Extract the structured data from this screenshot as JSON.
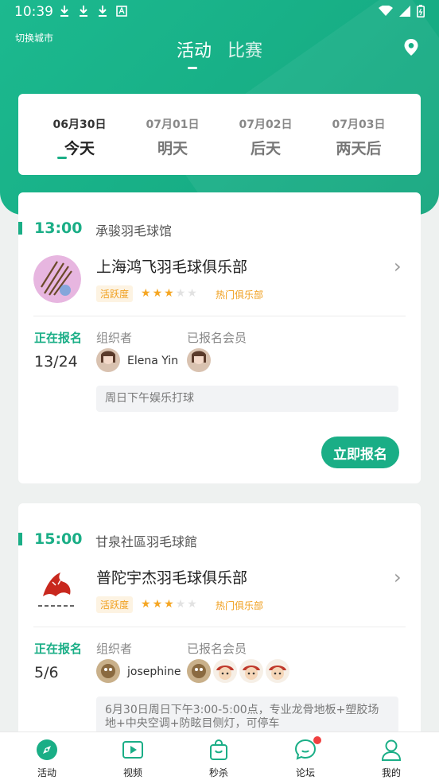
{
  "status_bar": {
    "time": "10:39",
    "icons": [
      "download-icon",
      "download-icon",
      "download-icon",
      "font-icon",
      "wifi-icon",
      "signal-icon",
      "battery-icon"
    ]
  },
  "header": {
    "city_switch": "切换城市",
    "tabs": [
      {
        "label": "活动",
        "active": true
      },
      {
        "label": "比赛",
        "active": false
      }
    ],
    "location_icon": "location-pin-icon"
  },
  "dates": [
    {
      "date": "06月30日",
      "label": "今天",
      "active": true
    },
    {
      "date": "07月01日",
      "label": "明天",
      "active": false
    },
    {
      "date": "07月02日",
      "label": "后天",
      "active": false
    },
    {
      "date": "07月03日",
      "label": "两天后",
      "active": false
    }
  ],
  "events": [
    {
      "time": "13:00",
      "venue": "承骏羽毛球馆",
      "club_name": "上海鸿飞羽毛球俱乐部",
      "activity_tag": "活跃度",
      "rating": 3,
      "rating_max": 5,
      "hot_tag": "热门俱乐部",
      "status_label": "正在报名",
      "count": "13/24",
      "organizer_label": "组织者",
      "organizer_name": "Elena Yin",
      "members_label": "已报名会员",
      "description": "周日下午娱乐打球",
      "cta": "立即报名"
    },
    {
      "time": "15:00",
      "venue": "甘泉社區羽毛球館",
      "club_name": "普陀宇杰羽毛球俱乐部",
      "activity_tag": "活跃度",
      "rating": 3,
      "rating_max": 5,
      "hot_tag": "热门俱乐部",
      "status_label": "正在报名",
      "count": "5/6",
      "organizer_label": "组织者",
      "organizer_name": "josephine",
      "members_label": "已报名会员",
      "description": "6月30日周日下午3:00-5:00点，专业龙骨地板+塑胶场地+中央空调+防眩目侧灯，可停车"
    }
  ],
  "tabbar": [
    {
      "label": "活动",
      "icon": "compass-icon",
      "active": true
    },
    {
      "label": "视频",
      "icon": "play-icon",
      "active": false
    },
    {
      "label": "秒杀",
      "icon": "shopping-bag-icon",
      "active": false
    },
    {
      "label": "论坛",
      "icon": "chat-bubble-icon",
      "active": false,
      "badge": true
    },
    {
      "label": "我的",
      "icon": "user-icon",
      "active": false
    }
  ],
  "colors": {
    "brand": "#1aae86",
    "accent_orange": "#f0a020",
    "badge": "#f04040"
  }
}
